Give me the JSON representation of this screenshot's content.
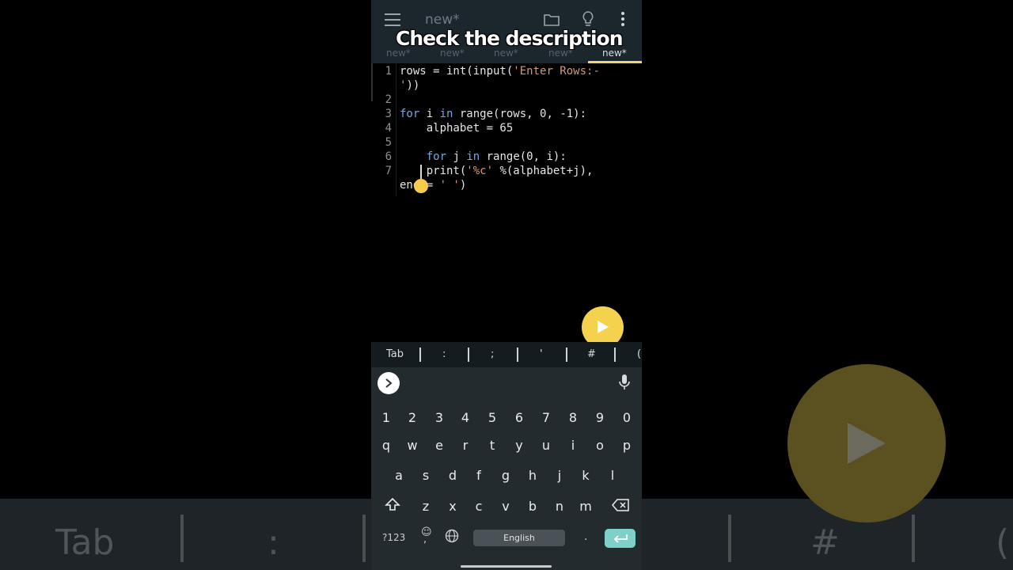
{
  "app": {
    "file_title": "new*",
    "banner_text": "Check the description",
    "tabs": [
      "new*",
      "new*",
      "new*",
      "new*",
      "new*"
    ],
    "active_tab_index": 4
  },
  "editor": {
    "line_numbers": [
      "1",
      "2",
      "3",
      "4",
      "5",
      "6",
      "7"
    ],
    "line1a_var": "rows = int(input(",
    "line1a_str": "'Enter Rows:-",
    "line1b_str": "'",
    "line1b_rest": "))",
    "line3_kw_for": "for",
    "line3_mid": " i ",
    "line3_kw_in": "in",
    "line3_rest": " range(rows, 0, -1):",
    "line4": "    alphabet = 65",
    "line6_indent": "    ",
    "line6_kw_for": "for",
    "line6_mid": " j ",
    "line6_kw_in": "in",
    "line6_rest": " range(0, i):",
    "line7_indent": "    print(",
    "line7_str": "'%c'",
    "line7_rest": " %(alphabet+j),",
    "line7b_a": "end = ",
    "line7b_str": "' '",
    "line7b_b": ")"
  },
  "symbol_bar": [
    "Tab",
    ":",
    ";",
    "'",
    "#",
    "("
  ],
  "keyboard": {
    "numbers": [
      "1",
      "2",
      "3",
      "4",
      "5",
      "6",
      "7",
      "8",
      "9",
      "0"
    ],
    "row1": [
      "q",
      "w",
      "e",
      "r",
      "t",
      "y",
      "u",
      "i",
      "o",
      "p"
    ],
    "row2": [
      "a",
      "s",
      "d",
      "f",
      "g",
      "h",
      "j",
      "k",
      "l"
    ],
    "row3": [
      "z",
      "x",
      "c",
      "v",
      "b",
      "n",
      "m"
    ],
    "symbols_key": "?123",
    "emoji_key": "☺",
    "comma_key": ",",
    "space_label": "English",
    "period_key": "."
  },
  "background": {
    "keys": [
      "Tab",
      ":",
      "#",
      "("
    ]
  },
  "colors": {
    "accent_yellow": "#f5d24e",
    "appbar": "#1c262d",
    "keyword_blue": "#7aa6e0",
    "string_orange": "#d59a75",
    "enter_teal": "#7ed1c9"
  }
}
